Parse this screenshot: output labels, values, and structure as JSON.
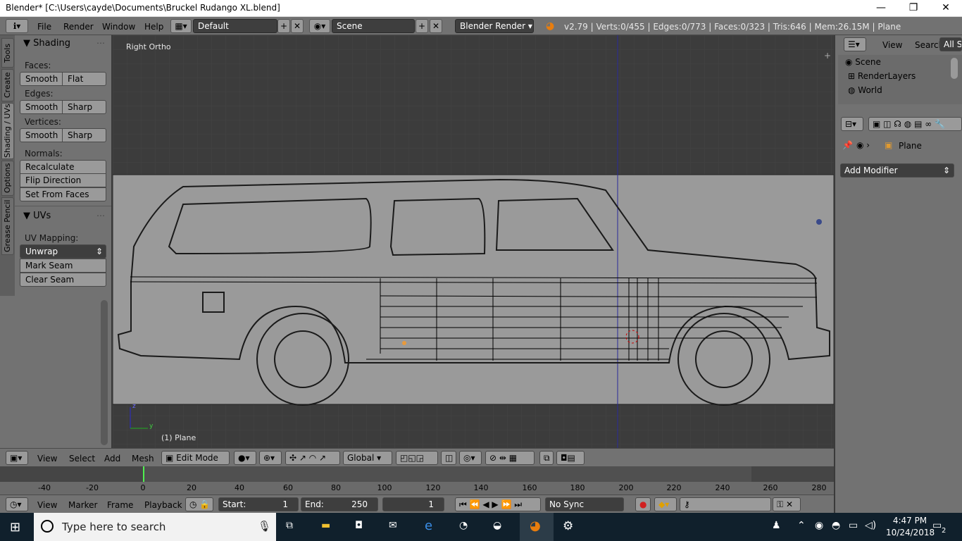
{
  "window": {
    "title": "Blender* [C:\\Users\\cayde\\Documents\\Bruckel Rudango XL.blend]",
    "minimize": "—",
    "maximize": "❐",
    "close": "✕"
  },
  "infobar": {
    "menus": [
      "File",
      "Render",
      "Window",
      "Help"
    ],
    "layout": "Default",
    "scene": "Scene",
    "engine": "Blender Render",
    "stats": "v2.79 | Verts:0/455 | Edges:0/773 | Faces:0/323 | Tris:646 | Mem:26.15M | Plane"
  },
  "tabs": [
    "Tools",
    "Create",
    "Shading / UVs",
    "Options",
    "Grease Pencil"
  ],
  "shading": {
    "title": "Shading",
    "faces_label": "Faces:",
    "faces": [
      "Smooth",
      "Flat"
    ],
    "edges_label": "Edges:",
    "edges": [
      "Smooth",
      "Sharp"
    ],
    "vertices_label": "Vertices:",
    "vertices": [
      "Smooth",
      "Sharp"
    ],
    "normals_label": "Normals:",
    "normals": [
      "Recalculate",
      "Flip Direction",
      "Set From Faces"
    ]
  },
  "uvs": {
    "title": "UVs",
    "mapping_label": "UV Mapping:",
    "mapping": "Unwrap",
    "buttons": [
      "Mark Seam",
      "Clear Seam"
    ]
  },
  "viewport": {
    "view_name": "Right Ortho",
    "object_name": "(1) Plane",
    "axis_z": "z",
    "axis_y": "y"
  },
  "viewheader": {
    "menus": [
      "View",
      "Select",
      "Add",
      "Mesh"
    ],
    "mode": "Edit Mode",
    "orientation": "Global"
  },
  "timeline": {
    "ticks": [
      "-40",
      "-20",
      "0",
      "20",
      "40",
      "60",
      "80",
      "100",
      "120",
      "140",
      "160",
      "180",
      "200",
      "220",
      "240",
      "260",
      "280"
    ]
  },
  "timeheader": {
    "menus": [
      "View",
      "Marker",
      "Frame",
      "Playback"
    ],
    "start": "Start:",
    "start_val": "1",
    "end": "End:",
    "end_val": "250",
    "current": "1",
    "sync": "No Sync"
  },
  "outliner": {
    "menus": [
      "View",
      "Search",
      "All Sc"
    ],
    "items": [
      "Scene",
      "RenderLayers",
      "World"
    ]
  },
  "properties": {
    "object": "Plane",
    "add_modifier": "Add Modifier"
  },
  "taskbar": {
    "search_placeholder": "Type here to search",
    "time": "4:47 PM",
    "date": "10/24/2018",
    "notif": "2"
  }
}
